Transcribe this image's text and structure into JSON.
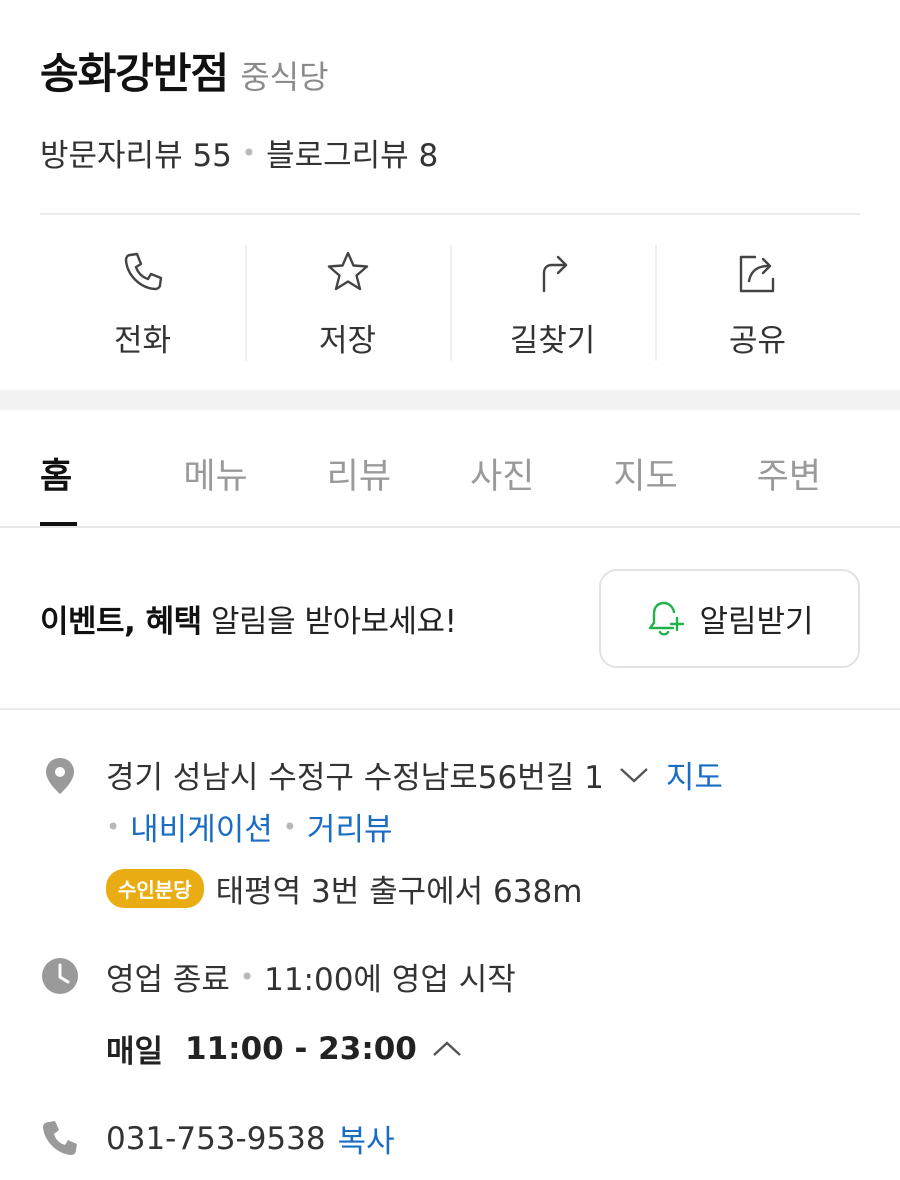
{
  "place": {
    "name": "송화강반점",
    "category": "중식당",
    "visitor_reviews": "방문자리뷰 55",
    "blog_reviews": "블로그리뷰 8"
  },
  "actions": [
    {
      "label": "전화",
      "icon": "phone-icon"
    },
    {
      "label": "저장",
      "icon": "star-icon"
    },
    {
      "label": "길찾기",
      "icon": "directions-icon"
    },
    {
      "label": "공유",
      "icon": "share-icon"
    }
  ],
  "tabs": [
    {
      "label": "홈",
      "active": true
    },
    {
      "label": "메뉴"
    },
    {
      "label": "리뷰"
    },
    {
      "label": "사진"
    },
    {
      "label": "지도"
    },
    {
      "label": "주변"
    }
  ],
  "promo": {
    "bold_text": "이벤트, 혜택",
    "text": " 알림을 받아보세요!",
    "button_label": "알림받기",
    "button_icon": "bell-plus-icon",
    "accent_color": "#22b14c"
  },
  "address": {
    "text": "경기 성남시 수정구 수정남로56번길 1",
    "map_link": "지도",
    "navigation_link": "내비게이션",
    "street_view_link": "거리뷰",
    "subway_badge": "수인분당",
    "subway_badge_color": "#e9ac12",
    "subway_text": "태평역 3번 출구에서 638m"
  },
  "hours": {
    "status": "영업 종료",
    "next_open": "11:00에 영업 시작",
    "days": "매일",
    "time": "11:00 - 23:00"
  },
  "phone": {
    "number": "031-753-9538",
    "copy_label": "복사"
  },
  "colors": {
    "link": "#1a6dc2",
    "icon_gray": "#9a9a9a"
  }
}
